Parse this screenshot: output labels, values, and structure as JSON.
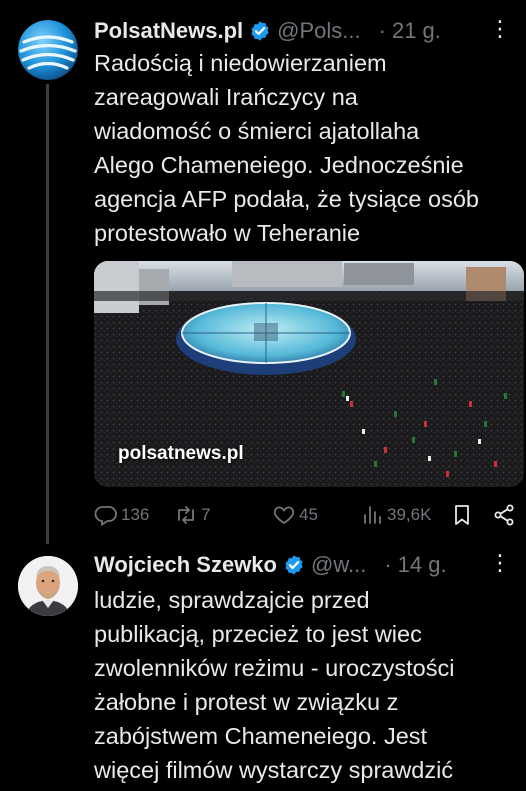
{
  "tweets": [
    {
      "author_name": "PolsatNews.pl",
      "handle": "@Pols...",
      "dot": "·",
      "time": "21 g.",
      "more": "⋮",
      "text": "Radością i niedowierzaniem\nzareagowali Irańczycy na\nwiadomość o śmierci ajatollaha\nAlego Chameneiego. Jednocześnie\nagencja AFP podała, że tysiące osób\nprotestowało w Teheranie",
      "media_watermark": "polsatnews.pl",
      "stats": {
        "replies": "136",
        "reposts": "7",
        "likes": "45",
        "views": "39,6K"
      }
    },
    {
      "author_name": "Wojciech Szewko",
      "handle": "@w...",
      "dot": "·",
      "time": "14 g.",
      "more": "⋮",
      "text": "ludzie, sprawdzajcie przed\npublikacją, przecież to jest wiec\nzwolenników reżimu - uroczystości\nżałobne i protest w związku z\nzabójstwem Chameneiego. Jest\nwięcej filmów wystarczy sprawdzić"
    }
  ],
  "colors": {
    "background": "#000000",
    "text": "#e7e9ea",
    "muted": "#71767b",
    "verified": "#1d9bf0"
  }
}
